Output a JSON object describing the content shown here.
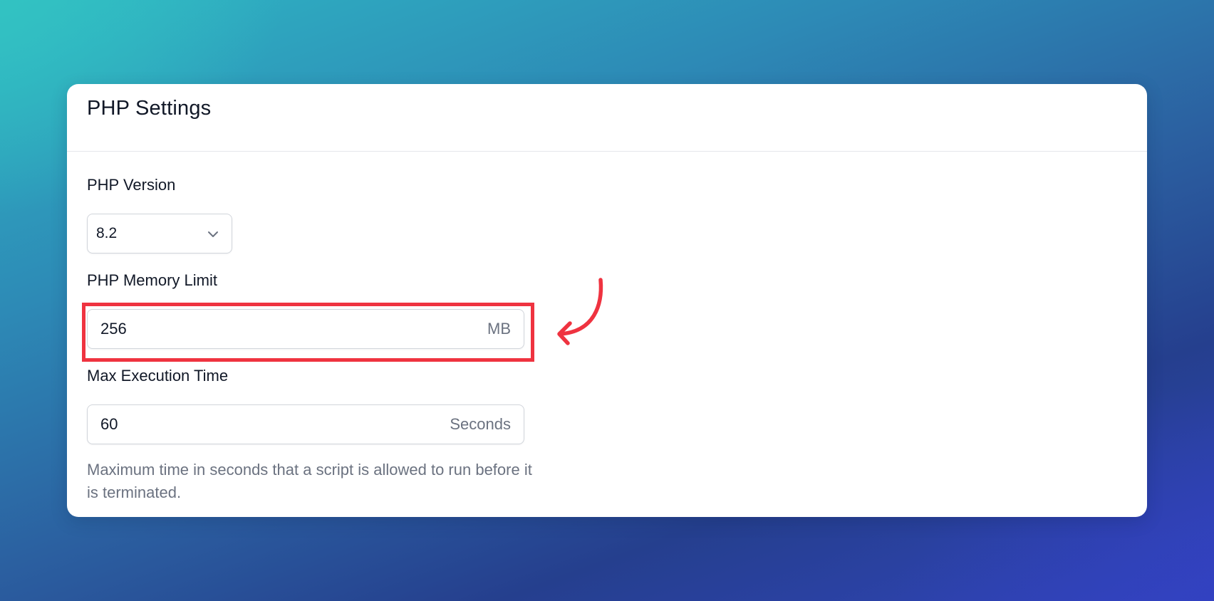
{
  "card": {
    "title": "PHP Settings"
  },
  "fields": {
    "php_version": {
      "label": "PHP Version",
      "value": "8.2",
      "icon": "chevron-down-icon"
    },
    "memory_limit": {
      "label": "PHP Memory Limit",
      "value": "256",
      "suffix": "MB"
    },
    "max_execution_time": {
      "label": "Max Execution Time",
      "value": "60",
      "suffix": "Seconds",
      "help": "Maximum time in seconds that a script is allowed to run before it is terminated."
    }
  },
  "annotation": {
    "highlight_color": "#ef3340"
  }
}
